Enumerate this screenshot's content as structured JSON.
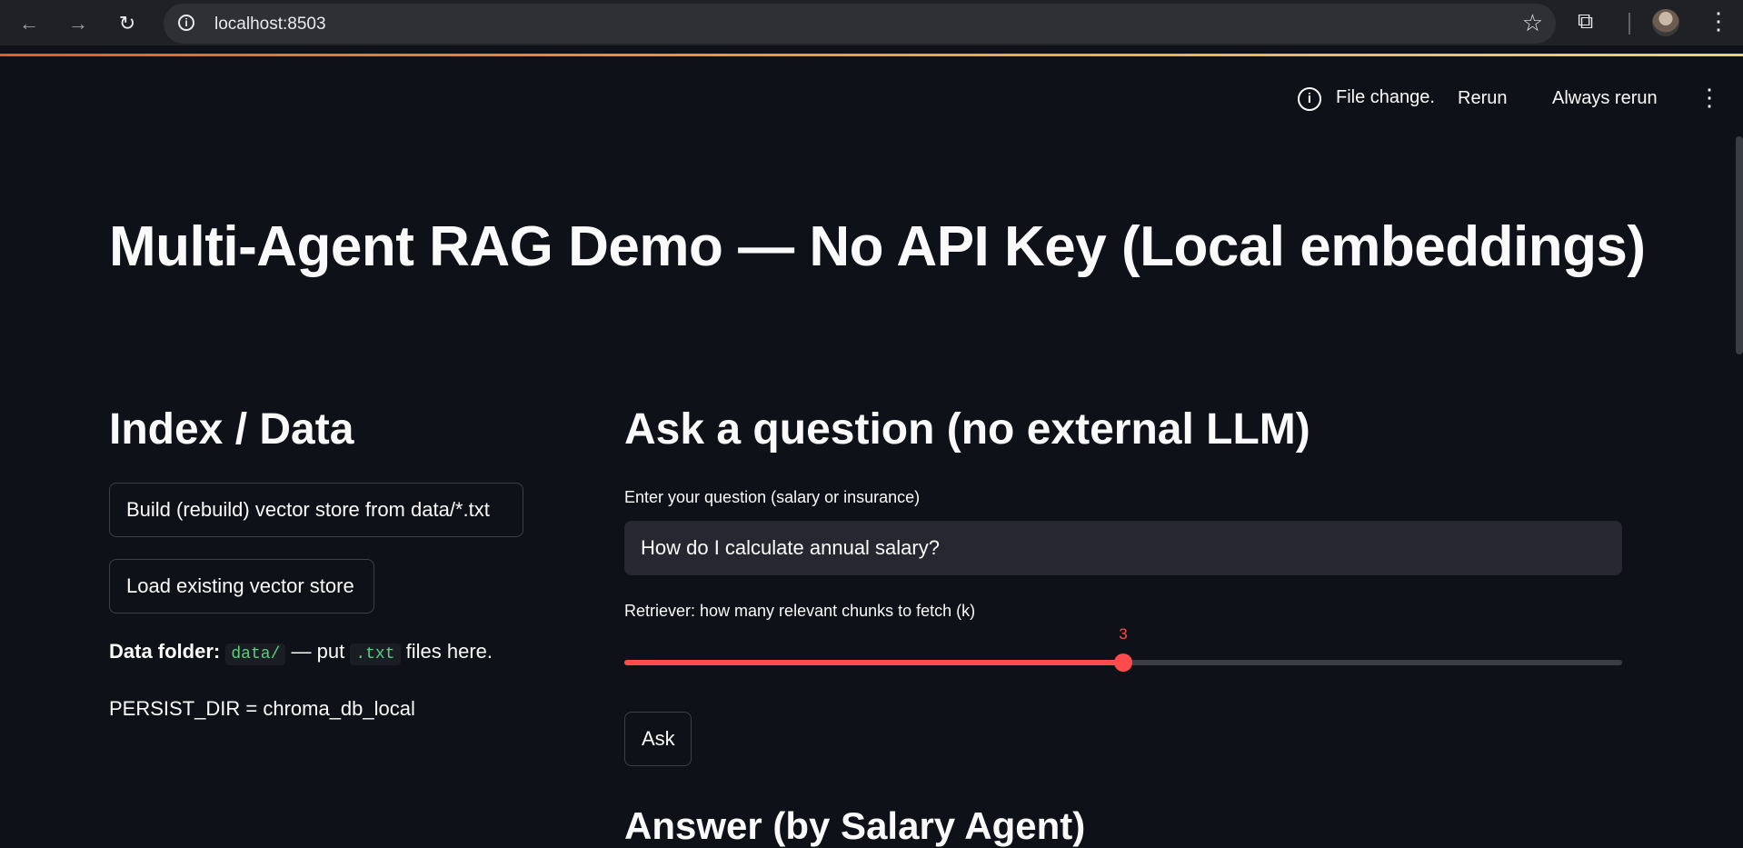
{
  "browser": {
    "url": "localhost:8503"
  },
  "toolbar": {
    "status_text": "File change.",
    "rerun_label": "Rerun",
    "always_rerun_label": "Always rerun"
  },
  "page": {
    "title": "Multi-Agent RAG Demo — No API Key (Local embeddings)"
  },
  "index_panel": {
    "heading": "Index / Data",
    "build_button": "Build (rebuild) vector store from data/*.txt",
    "load_button": "Load existing vector store",
    "data_folder_bold": "Data folder:",
    "data_folder_code": "data/",
    "data_folder_mid": " — put ",
    "data_folder_ext": ".txt",
    "data_folder_tail": " files here.",
    "persist_dir": "PERSIST_DIR = chroma_db_local"
  },
  "question_panel": {
    "heading": "Ask a question (no external LLM)",
    "input_label": "Enter your question (salary or insurance)",
    "input_value": "How do I calculate annual salary?",
    "slider_label": "Retriever: how many relevant chunks to fetch (k)",
    "slider_value": "3",
    "slider_fraction": 0.5,
    "ask_button": "Ask",
    "answer_heading": "Answer (by Salary Agent)"
  },
  "colors": {
    "background": "#0e1117",
    "accent": "#ff4b4b",
    "code_text": "#5ccf7d"
  }
}
